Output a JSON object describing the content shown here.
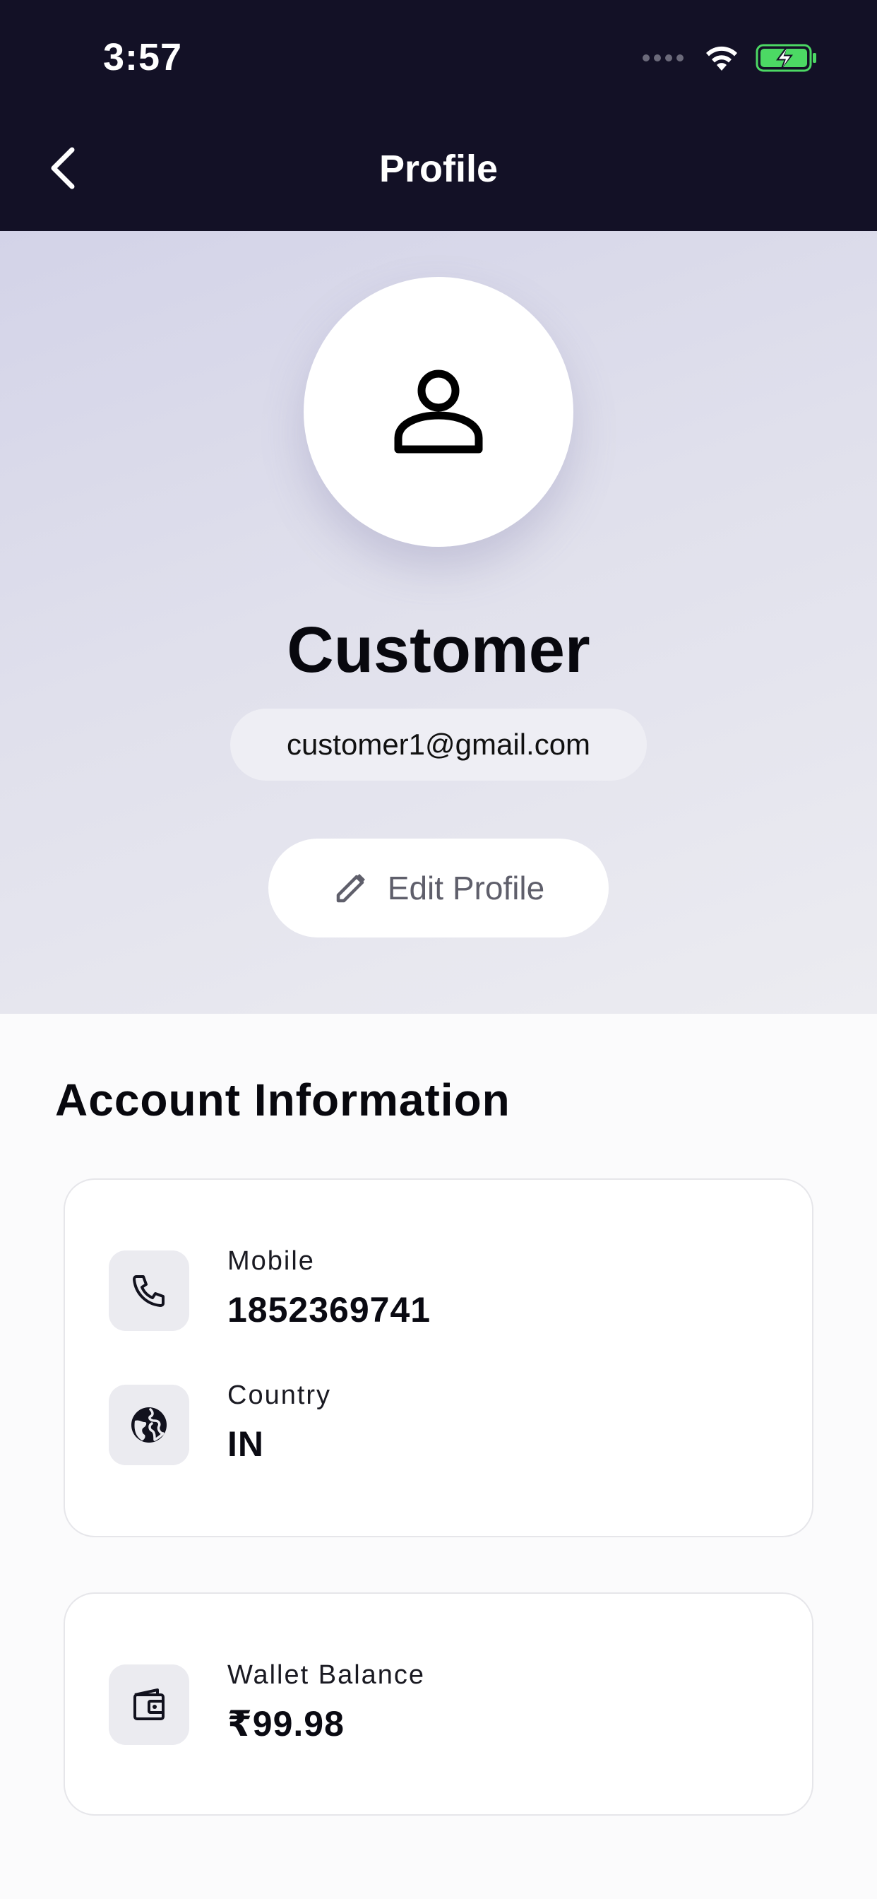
{
  "status_bar": {
    "time": "3:57"
  },
  "nav": {
    "title": "Profile",
    "back_icon": "chevron-left-icon"
  },
  "profile": {
    "avatar_icon": "person-icon",
    "name": "Customer",
    "email": "customer1@gmail.com",
    "edit_label": "Edit Profile",
    "edit_icon": "pencil-icon"
  },
  "account": {
    "section_title": "Account Information",
    "rows": [
      {
        "label": "Mobile",
        "value": "1852369741",
        "icon": "phone-icon"
      },
      {
        "label": "Country",
        "value": "IN",
        "icon": "globe-icon"
      }
    ],
    "wallet": {
      "label": "Wallet Balance",
      "value": "₹99.98",
      "icon": "wallet-icon"
    }
  },
  "colors": {
    "topbar": "#131126",
    "header_gradient_start": "#d3d3e8",
    "header_gradient_end": "#ececf1",
    "battery_fill": "#4cd964"
  }
}
